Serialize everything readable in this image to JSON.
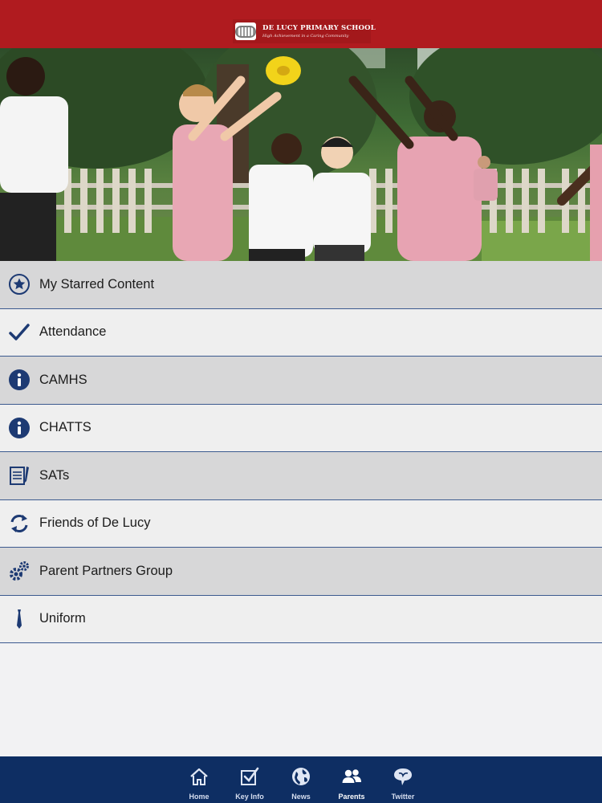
{
  "header": {
    "school_name": "DE LUCY PRIMARY SCHOOL",
    "motto": "High Achievement in a Caring Community",
    "background_color": "#b01b1f"
  },
  "hero": {
    "icon": "children-playing-photo"
  },
  "menu": {
    "items": [
      {
        "label": "My Starred Content",
        "icon": "star-circle-icon"
      },
      {
        "label": "Attendance",
        "icon": "checkmark-icon"
      },
      {
        "label": "CAMHS",
        "icon": "info-icon"
      },
      {
        "label": "CHATTS",
        "icon": "info-icon"
      },
      {
        "label": "SATs",
        "icon": "document-pencil-icon"
      },
      {
        "label": "Friends of De Lucy",
        "icon": "refresh-arrows-icon"
      },
      {
        "label": "Parent Partners Group",
        "icon": "gears-icon"
      },
      {
        "label": "Uniform",
        "icon": "tie-icon"
      }
    ],
    "accent_color": "#1d3a73"
  },
  "tabbar": {
    "background_color": "#0e2e63",
    "active": "Parents",
    "tabs": [
      {
        "label": "Home",
        "icon": "home-icon"
      },
      {
        "label": "Key Info",
        "icon": "checkbox-icon"
      },
      {
        "label": "News",
        "icon": "globe-icon"
      },
      {
        "label": "Parents",
        "icon": "people-icon"
      },
      {
        "label": "Twitter",
        "icon": "speech-bubble-icon"
      }
    ]
  }
}
